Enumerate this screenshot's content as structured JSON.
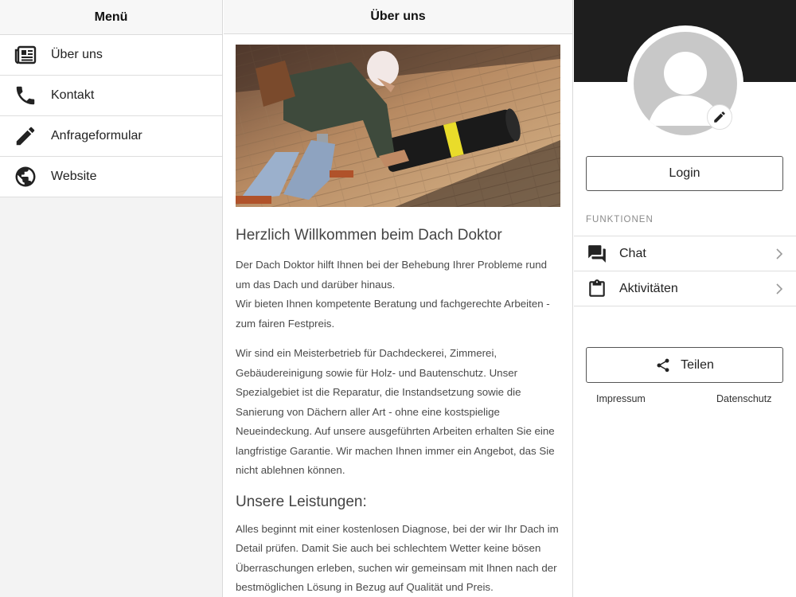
{
  "menu": {
    "title": "Menü",
    "items": [
      {
        "label": "Über uns",
        "icon": "newspaper-icon"
      },
      {
        "label": "Kontakt",
        "icon": "phone-icon"
      },
      {
        "label": "Anfrageformular",
        "icon": "pencil-icon"
      },
      {
        "label": "Website",
        "icon": "globe-icon"
      }
    ]
  },
  "content": {
    "title": "Über uns",
    "heading1": "Herzlich Willkommen beim Dach Doktor",
    "para1_line1": "Der Dach Doktor hilft Ihnen bei der Behebung Ihrer Probleme rund um das Dach und darüber hinaus.",
    "para1_line2": "Wir bieten Ihnen kompetente Beratung und fachgerechte Arbeiten - zum fairen Festpreis.",
    "para2": "Wir sind ein Meisterbetrieb für Dachdeckerei, Zimmerei, Gebäudereinigung sowie für Holz- und Bautenschutz. Unser Spezialgebiet ist die Reparatur, die Instandsetzung sowie die Sanierung von Dächern aller Art - ohne eine kostspielige Neueindeckung. Auf unsere ausgeführten Arbeiten erhalten Sie eine langfristige Garantie. Wir machen Ihnen immer ein Angebot, das Sie nicht ablehnen können.",
    "heading2": "Unsere Leistungen:",
    "para3": "Alles beginnt mit einer kostenlosen Diagnose, bei der wir Ihr Dach im Detail prüfen. Damit Sie auch bei schlechtem Wetter keine bösen Überraschungen erleben, suchen wir gemeinsam mit Ihnen nach der bestmöglichen Lösung in Bezug auf Qualität und Preis."
  },
  "profile": {
    "login_label": "Login",
    "section_label": "FUNKTIONEN",
    "functions": [
      {
        "label": "Chat",
        "icon": "chat-icon"
      },
      {
        "label": "Aktivitäten",
        "icon": "clipboard-icon"
      }
    ],
    "share_label": "Teilen",
    "impressum": "Impressum",
    "datenschutz": "Datenschutz"
  },
  "colors": {
    "header_dark": "#1e1e1e",
    "avatar_gray": "#c8c8c8",
    "menu_bg": "#f3f3f3"
  }
}
